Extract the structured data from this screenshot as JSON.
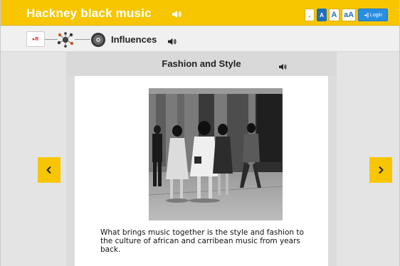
{
  "header": {
    "title": "Hackney black music",
    "title_speaker_icon": "speaker-icon",
    "text_size_tools": [
      ".",
      "A",
      "A",
      "aA"
    ],
    "login_label": "Login"
  },
  "breadcrumb": {
    "logo_text_prefix": "▸R",
    "logo_text_suffix": "",
    "current_label": "Influences",
    "speaker_icon": "speaker-icon"
  },
  "card": {
    "title": "Fashion and Style",
    "caption": "What brings music together is the style and fashion to the culture of african and carribean music from years back."
  },
  "navigation": {
    "prev_symbol": "‹",
    "next_symbol": "›"
  },
  "colors": {
    "accent": "#f7c600",
    "login_blue": "#2a8ee0",
    "panel_grey": "#d9d9d9"
  }
}
